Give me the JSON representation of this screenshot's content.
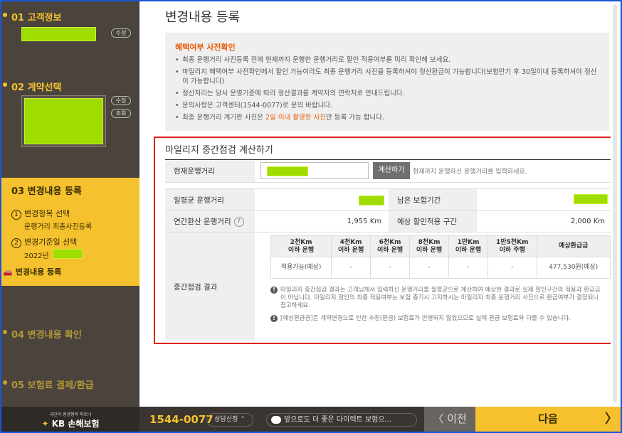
{
  "sidebar": {
    "step1": {
      "label": "01 고객정보",
      "edit": "수정"
    },
    "step2": {
      "label": "02 계약선택",
      "edit": "수정",
      "view": "조회"
    },
    "step3": {
      "label": "03 변경내용 등록",
      "sub1": {
        "num": "1",
        "label": "변경항목 선택",
        "detail": "운행거리 최종사진등록"
      },
      "sub2": {
        "num": "2",
        "label": "변경기준일 선택",
        "detail": "2022년"
      },
      "sub3": {
        "label": "변경내용 등록"
      }
    },
    "step4": {
      "label": "04 변경내용 확인"
    },
    "step5": {
      "label": "05 보험료 결제/환급"
    }
  },
  "main": {
    "title": "변경내용 등록",
    "notice": {
      "heading": "혜택여부 사전확인",
      "items": [
        "최종 운행거리 사진등록 전에 현재까지 운행한 운행거리로 할인 적용여부를 미리 확인해 보세요.",
        "마일리지 혜택여부 사전확인에서 할인 가능이라도 최종 운행거리 사진을 등록하셔야 정산환급이 가능합니다(보험만기 후 30일이내 등록하셔야 정산이 가능합니다)",
        "정산처리는 당사 운영기준에 따라 정산결과를 계약자의 연락처로 안내드립니다.",
        "문의사항은 고객센터(1544-0077)로 문의 바랍니다."
      ],
      "last_pre": "최종 운행거리 계기판 사진은 ",
      "last_red": "2일 이내 촬영한 사진",
      "last_post": "만 등록 가능 합니다."
    },
    "calc": {
      "title": "마일리지 중간점검 계산하기",
      "current_label": "현재운행거리",
      "calc_button": "계산하기",
      "calc_hint": "현재까지 운행하신 운행거리를 입력하세요.",
      "daily_label": "일평균 운행거리",
      "remain_label": "남은 보험기간",
      "annual_label": "연간환산 운행거리",
      "annual_value": "1,955 Km",
      "expected_label": "예상 할인적용 구간",
      "expected_value": "2,000 Km",
      "result_label": "중간점검 결과",
      "columns": [
        "2천Km\n이하 운행",
        "4천Km\n이하 운행",
        "6천Km\n이하 운행",
        "8천Km\n이하 운행",
        "1만Km\n이하 운행",
        "1만5천Km\n이하 주행",
        "예상환급금"
      ],
      "values": [
        "적용가능(예상)",
        "-",
        "-",
        "-",
        "-",
        "-",
        "477,530원(예상)"
      ],
      "note1": "마일리지 중간점검 결과는 고객님께서 입력하신 운행거리를 월평균으로 계산하여 예상한 결과로 실제 할인구간의 적용과 환급금이 아닙니다. 마일리지 할인의 최종 적용여부는 보험 종기시 고지하시는 마일리지 최종 운행거리 사진으로 환급여부가 결정되니 참고하세요.",
      "note2": "[예상환급금]은 계약변경으로 인한 추징(환급) 보험료가 반영되지 않았으므로 실제 환급 보험료와 다를 수 있습니다."
    }
  },
  "bottom": {
    "logo_sub": "국민의 평생행복 파트너",
    "logo_star": "✦",
    "logo_main": "KB 손해보험",
    "phone": "1544-0077",
    "consult": "상담신청 ⌃",
    "chat": "앞으로도 더 좋은 다이렉트 보험으...",
    "prev": "〈 이전",
    "next": "다음",
    "next_arrow": "〉"
  }
}
